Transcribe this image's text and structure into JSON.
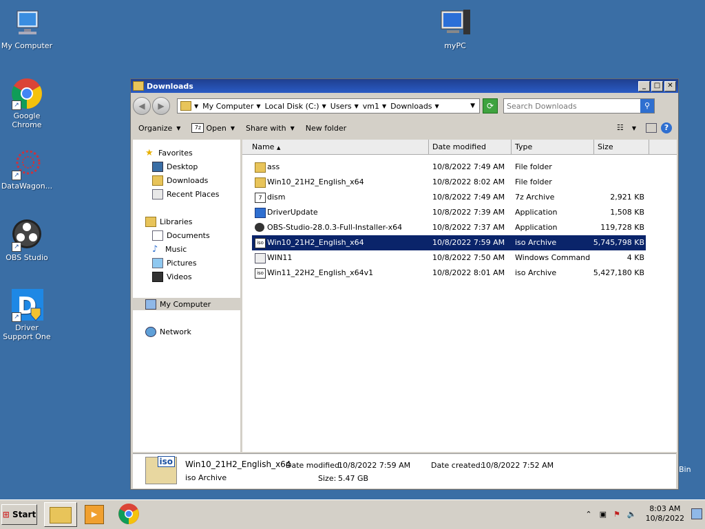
{
  "desktop": {
    "icons": [
      {
        "label": "My Computer"
      },
      {
        "label": "Google Chrome"
      },
      {
        "label": "DataWagon..."
      },
      {
        "label": "OBS Studio"
      },
      {
        "label": "Driver Support One"
      },
      {
        "label": "myPC"
      }
    ],
    "recycle_label": "Bin"
  },
  "window": {
    "title": "Downloads",
    "address": [
      "My Computer",
      "Local Disk (C:)",
      "Users",
      "vm1",
      "Downloads"
    ],
    "search_placeholder": "Search Downloads",
    "toolbar": {
      "organize": "Organize",
      "open": "Open",
      "share": "Share with",
      "new_folder": "New folder"
    }
  },
  "nav": {
    "favorites": "Favorites",
    "desktop": "Desktop",
    "downloads": "Downloads",
    "recent": "Recent Places",
    "libraries": "Libraries",
    "documents": "Documents",
    "music": "Music",
    "pictures": "Pictures",
    "videos": "Videos",
    "my_computer": "My Computer",
    "network": "Network"
  },
  "columns": {
    "name": "Name",
    "date": "Date modified",
    "type": "Type",
    "size": "Size"
  },
  "files": [
    {
      "name": "ass",
      "date": "10/8/2022 7:49 AM",
      "type": "File folder",
      "size": ""
    },
    {
      "name": "Win10_21H2_English_x64",
      "date": "10/8/2022 8:02 AM",
      "type": "File folder",
      "size": ""
    },
    {
      "name": "dism",
      "date": "10/8/2022 7:49 AM",
      "type": "7z Archive",
      "size": "2,921 KB"
    },
    {
      "name": "DriverUpdate",
      "date": "10/8/2022 7:39 AM",
      "type": "Application",
      "size": "1,508 KB"
    },
    {
      "name": "OBS-Studio-28.0.3-Full-Installer-x64",
      "date": "10/8/2022 7:37 AM",
      "type": "Application",
      "size": "119,728 KB"
    },
    {
      "name": "Win10_21H2_English_x64",
      "date": "10/8/2022 7:59 AM",
      "type": "iso Archive",
      "size": "5,745,798 KB"
    },
    {
      "name": "WIN11",
      "date": "10/8/2022 7:50 AM",
      "type": "Windows Command ...",
      "size": "4 KB"
    },
    {
      "name": "Win11_22H2_English_x64v1",
      "date": "10/8/2022 8:01 AM",
      "type": "iso Archive",
      "size": "5,427,180 KB"
    }
  ],
  "details": {
    "name": "Win10_21H2_English_x64",
    "type": "iso Archive",
    "modified_label": "Date modified:",
    "modified": "10/8/2022 7:59 AM",
    "size_label": "Size:",
    "size": "5.47 GB",
    "created_label": "Date created:",
    "created": "10/8/2022 7:52 AM",
    "icon_text": "iso"
  },
  "taskbar": {
    "start": "Start",
    "time": "8:03 AM",
    "date": "10/8/2022"
  },
  "colors": {
    "desktop": "#3a6ea5",
    "selection": "#0a246a",
    "titlebar": "#2a5bc4"
  }
}
